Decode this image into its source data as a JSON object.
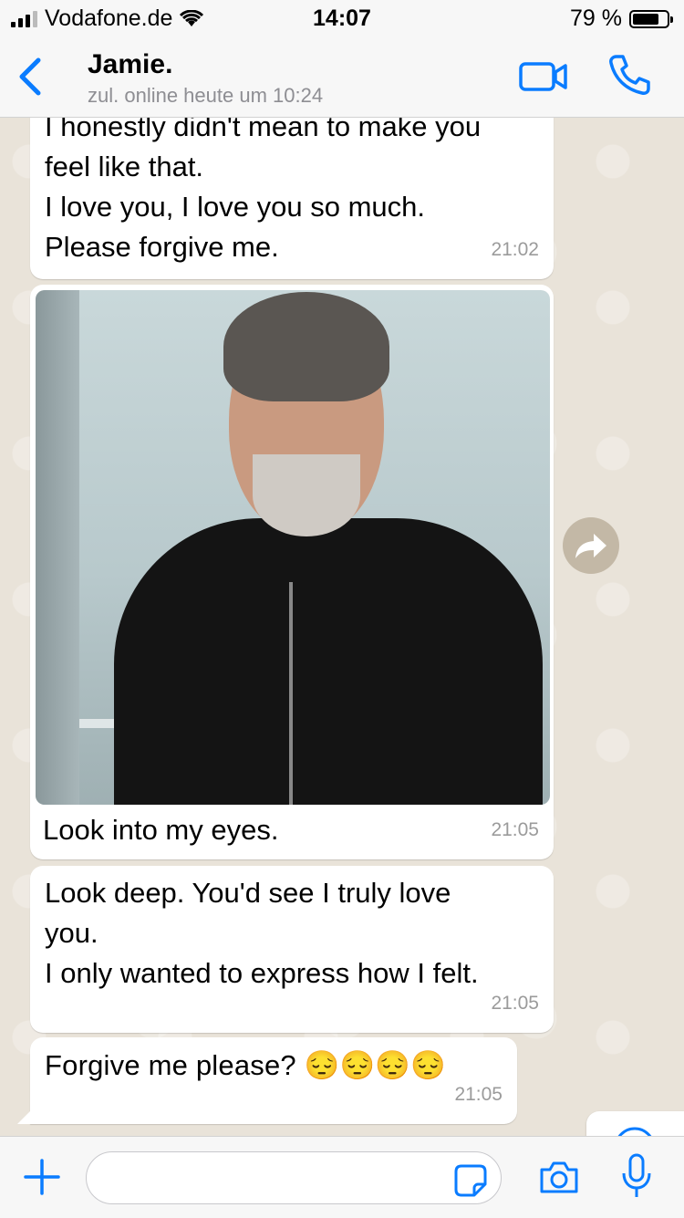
{
  "status_bar": {
    "carrier": "Vodafone.de",
    "time": "14:07",
    "battery": "79 %",
    "battery_level": 0.79
  },
  "header": {
    "contact_name": "Jamie.",
    "contact_status": "zul. online heute um 10:24"
  },
  "messages": [
    {
      "lines": [
        "I honestly didn't mean to make you",
        "feel like that.",
        "I love you, I love you so much.",
        "Please forgive me."
      ],
      "time": "21:02"
    },
    {
      "caption": "Look into my eyes.",
      "time": "21:05",
      "has_photo": true
    },
    {
      "lines": [
        "Look deep. You'd see I truly love",
        "you.",
        "I only wanted to express how I felt."
      ],
      "time": "21:05"
    },
    {
      "text": "Forgive me please? 😔😔😔😔",
      "time": "21:05"
    }
  ],
  "input": {
    "placeholder": ""
  },
  "icons": {
    "back": "chevron-left-icon",
    "video": "video-call-icon",
    "call": "phone-icon",
    "forward": "forward-icon",
    "scroll_down": "chevron-down-icon",
    "plus": "plus-icon",
    "sticker": "sticker-icon",
    "camera": "camera-icon",
    "mic": "microphone-icon"
  },
  "colors": {
    "accent": "#0a7cff",
    "bubble": "#ffffff",
    "background": "#e9e3d9",
    "timestamp": "#9b9b9b"
  }
}
